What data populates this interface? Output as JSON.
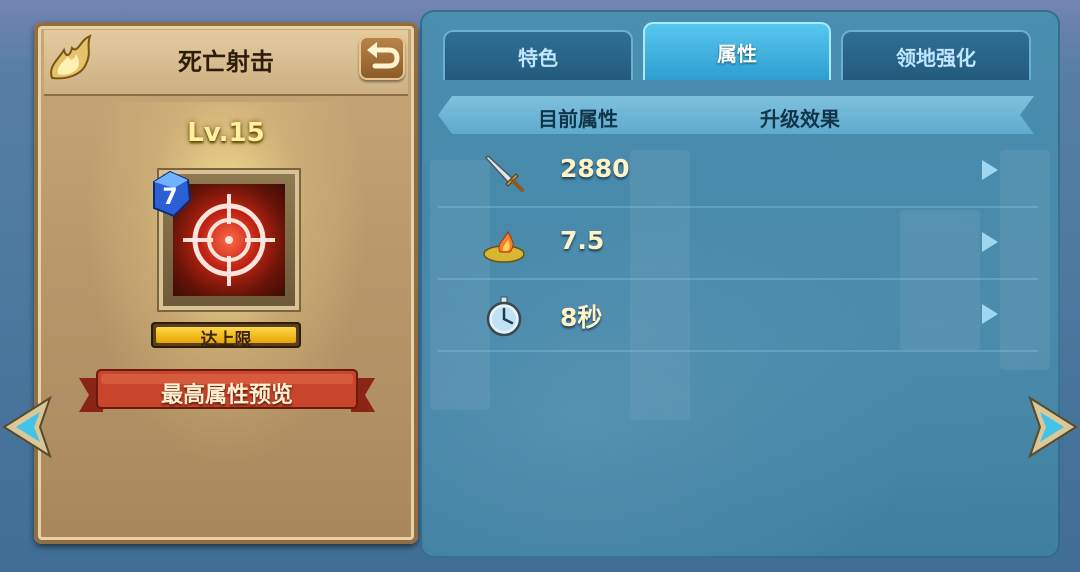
{
  "card": {
    "title": "死亡射击",
    "level": "Lv.15",
    "gem_count": "7",
    "cap_text": "达上限",
    "preview_button": "最高属性预览"
  },
  "tabs": [
    {
      "label": "特色",
      "active": false
    },
    {
      "label": "属性",
      "active": true
    },
    {
      "label": "领地强化",
      "active": false
    }
  ],
  "table": {
    "header_current": "目前属性",
    "header_upgrade": "升级效果",
    "rows": [
      {
        "icon": "sword-icon",
        "value": "2880"
      },
      {
        "icon": "flame-area-icon",
        "value": "7.5"
      },
      {
        "icon": "stopwatch-icon",
        "value": "8秒"
      }
    ]
  },
  "colors": {
    "accent_tab": "#3aa8d8",
    "value_text": "#fff3c8",
    "card_bg": "#b7976a",
    "ribbon": "#b83a22"
  }
}
